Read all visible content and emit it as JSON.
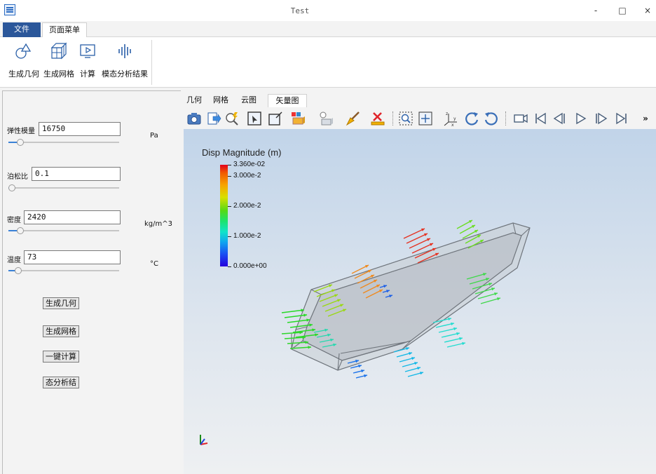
{
  "window": {
    "title": "Test",
    "minimize": "-",
    "maximize": "□",
    "close": "×"
  },
  "menu": {
    "tabs": [
      "文件",
      "页面菜单"
    ]
  },
  "ribbon": {
    "buttons": [
      {
        "label": "生成几何",
        "icon": "geometry-icon"
      },
      {
        "label": "生成网格",
        "icon": "mesh-cube-icon"
      },
      {
        "label": "计算",
        "icon": "compute-monitor-icon"
      },
      {
        "label": "模态分析结果",
        "icon": "modal-signal-icon"
      }
    ]
  },
  "params": {
    "modulus": {
      "label": "弹性模量",
      "value": "16750",
      "unit": "Pa",
      "slider_fraction": 0.08
    },
    "poisson": {
      "label": "泊松比",
      "value": "0.1",
      "unit": "",
      "slider_fraction": 0.0
    },
    "density": {
      "label": "密度",
      "value": "2420",
      "unit": "kg/m^3",
      "slider_fraction": 0.08
    },
    "temperature": {
      "label": "温度",
      "value": "73",
      "unit": "°C",
      "slider_fraction": 0.06
    }
  },
  "actions": [
    "生成几何",
    "生成网格",
    "一键计算",
    "态分析结"
  ],
  "view_tabs": [
    "几何",
    "网格",
    "云图",
    "矢量图"
  ],
  "active_view_tab": "矢量图",
  "toolbar": {
    "icons": [
      "camera-icon",
      "export-icon",
      "zoom-pick-icon",
      "select-box-icon",
      "select-point-icon",
      "display-mode-icon",
      "light-icon",
      "brush-icon",
      "clear-icon",
      "zoom-window-icon",
      "fit-view-icon",
      "axes-icon",
      "rotate-cw-icon",
      "rotate-ccw-icon",
      "video-camera-icon",
      "skip-first-icon",
      "step-back-icon",
      "play-icon",
      "step-forward-icon",
      "skip-last-icon",
      "more-icon"
    ],
    "more": "»"
  },
  "legend": {
    "title": "Disp Magnitude (m)",
    "labels": [
      "3.360e-02",
      "3.000e-2",
      "2.000e-2",
      "1.000e-2",
      "0.000e+00"
    ],
    "values": [
      0.0336,
      0.03,
      0.02,
      0.01,
      0.0
    ],
    "max": 0.0336
  },
  "colors": {
    "accent": "#2b579a",
    "slider": "#3b82d6"
  }
}
